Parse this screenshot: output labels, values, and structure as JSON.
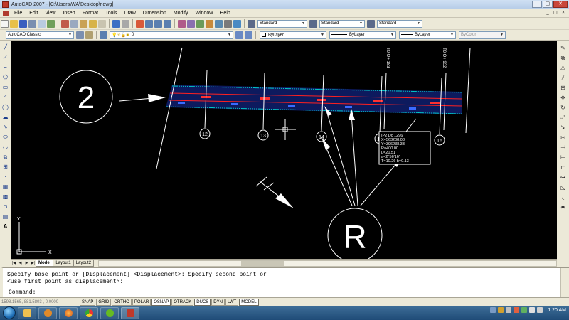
{
  "window": {
    "title": "AutoCAD 2007 - [C:\\Users\\WA\\Desktop\\r.dwg]",
    "controls": {
      "minimize": "_",
      "restore": "▢",
      "close": "✕"
    }
  },
  "menu": {
    "items": [
      "File",
      "Edit",
      "View",
      "Insert",
      "Format",
      "Tools",
      "Draw",
      "Dimension",
      "Modify",
      "Window",
      "Help"
    ],
    "doc_controls": {
      "minimize": "_",
      "restore": "▢",
      "close": "×"
    }
  },
  "styles_toolbar": {
    "text_style": "Standard",
    "dim_style": "Standard",
    "table_style": "Standard"
  },
  "workspace": {
    "name": "AutoCAD Classic"
  },
  "layers_toolbar": {
    "current_layer": "0"
  },
  "properties_toolbar": {
    "color": "ByLayer",
    "linetype": "ByLayer",
    "lineweight": "ByLayer",
    "plot_style": "ByColor"
  },
  "drawing": {
    "big_label_1": "2",
    "big_label_2": "R",
    "station_12": "12",
    "station_13": "13",
    "station_14": "14",
    "station_15": "15",
    "station_16": "16",
    "vertical_label_1": "T0 O+ 183",
    "vertical_label_2": "T0 O+ 932",
    "info_box": {
      "line1": "IP2   Dc 1296",
      "line2": "X=563208.08",
      "line3": "Y=396238.33",
      "line4": "R=400.00",
      "line5": "L=20.51",
      "line6": "a=2°56'16\"",
      "line7": "T=10.26  b=0.13"
    },
    "ucs_x": "X",
    "ucs_y": "Y",
    "colors": {
      "background": "#000000",
      "cyan_edge": "#00c8c8",
      "red_centerline": "#ff2020",
      "blue_band": "#1a2a8a",
      "white_linework": "#ffffff"
    }
  },
  "layout_tabs": {
    "nav": [
      "|◀",
      "◀",
      "▶",
      "▶|"
    ],
    "tabs": [
      "Model",
      "Layout1",
      "Layout2"
    ],
    "active": "Model"
  },
  "command_window": {
    "line1": "Specify base point or [Displacement] <Displacement>: Specify second point or",
    "line2": "<use first point as displacement>:",
    "prompt": "Command:"
  },
  "status_bar": {
    "coordinates": "1598.1565, 881.5803 , 0.0000",
    "toggles": [
      "SNAP",
      "GRID",
      "ORTHO",
      "POLAR",
      "OSNAP",
      "OTRACK",
      "DUCS",
      "DYN",
      "LWT",
      "MODEL"
    ],
    "on": [
      "OSNAP",
      "DUCS",
      "MODEL"
    ]
  },
  "taskbar": {
    "time": "1:20 AM",
    "apps": [
      "windows-explorer",
      "media-player",
      "firefox",
      "chrome",
      "utorrent",
      "autocad"
    ]
  }
}
